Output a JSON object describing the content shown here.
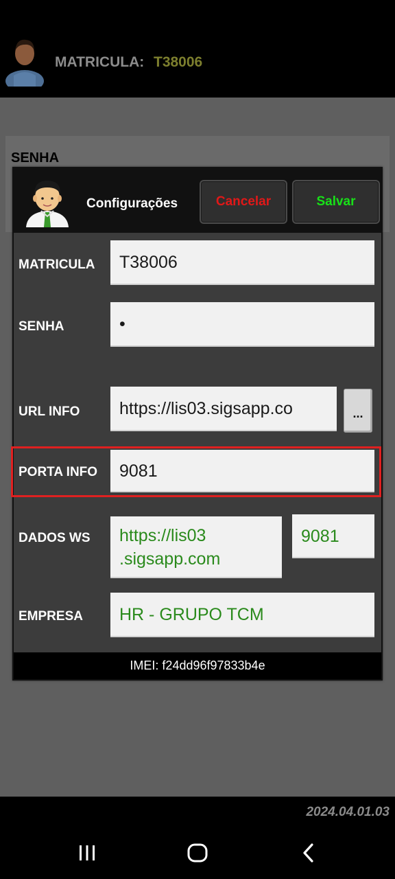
{
  "topbar": {
    "matricula_label": "MATRICULA:",
    "matricula_value": "T38006"
  },
  "background": {
    "senha_label": "SENHA"
  },
  "dialog": {
    "title": "Configurações",
    "cancel_label": "Cancelar",
    "save_label": "Salvar",
    "fields": {
      "matricula": {
        "label": "MATRICULA",
        "value": "T38006"
      },
      "senha": {
        "label": "SENHA",
        "value": "•"
      },
      "url_info": {
        "label": "URL INFO",
        "value": "https://lis03.sigsapp.co",
        "button_label": "..."
      },
      "porta_info": {
        "label": "PORTA INFO",
        "value": "9081"
      },
      "dados_ws": {
        "label": "DADOS WS",
        "url_value": "https://lis03 .sigsapp.com",
        "port_value": "9081"
      },
      "empresa": {
        "label": "EMPRESA",
        "value": "HR - GRUPO TCM"
      }
    },
    "imei": "IMEI: f24dd96f97833b4e"
  },
  "footer": {
    "version": "2024.04.01.03"
  },
  "colors": {
    "cancel": "#e01818",
    "save": "#18e018",
    "green_text": "#2a8a1c",
    "highlight": "#e02020"
  },
  "icons": [
    "user-avatar-icon",
    "recents-icon",
    "home-icon",
    "back-icon"
  ]
}
